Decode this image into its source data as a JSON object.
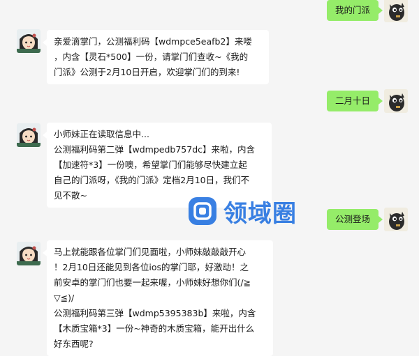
{
  "messages": [
    {
      "side": "right",
      "text": "我的门派"
    },
    {
      "side": "left",
      "lines": [
        "亲爱滴掌门，公测福利码【wdmpce5eafb2】来喽",
        "，内含【灵石*500】一份，请掌门们查收~《我的",
        "门派》公测于2月10日开启，欢迎掌门们的到来!"
      ]
    },
    {
      "side": "right",
      "text": "二月十日"
    },
    {
      "side": "left",
      "lines": [
        "小师妹正在读取信息中...",
        "公测福利码第二弹【wdmpedb757dc】来啦，内含",
        "【加速符*3】一份噢，希望掌门们能够尽快建立起",
        "自己的门派呀，《我的门派》定档2月10日，我们不",
        "见不散~"
      ]
    },
    {
      "side": "right",
      "text": "公测登场"
    },
    {
      "side": "left",
      "lines": [
        "马上就能跟各位掌门们见面啦，小师妹敲敲敲开心",
        "！2月10日还能见到各位ios的掌门耶，好激动！之",
        "前安卓的掌门们也要一起来喔，小师妹好想你们(/≧",
        "▽≦)/",
        "公测福利码第三弹【wdmp5395383b】来啦，内含",
        "【木质宝箱*3】一份~神奇的木质宝箱，能开出什么",
        "好东西呢?"
      ]
    }
  ],
  "watermark": {
    "text": "领域圈",
    "color": "#1f6fe0"
  },
  "colors": {
    "background": "#f5f5f5",
    "right_bubble": "#95ec69",
    "left_bubble": "#ffffff"
  },
  "icons": {
    "left_avatar": "girl-avatar-icon",
    "right_avatar": "dog-avatar-icon"
  }
}
